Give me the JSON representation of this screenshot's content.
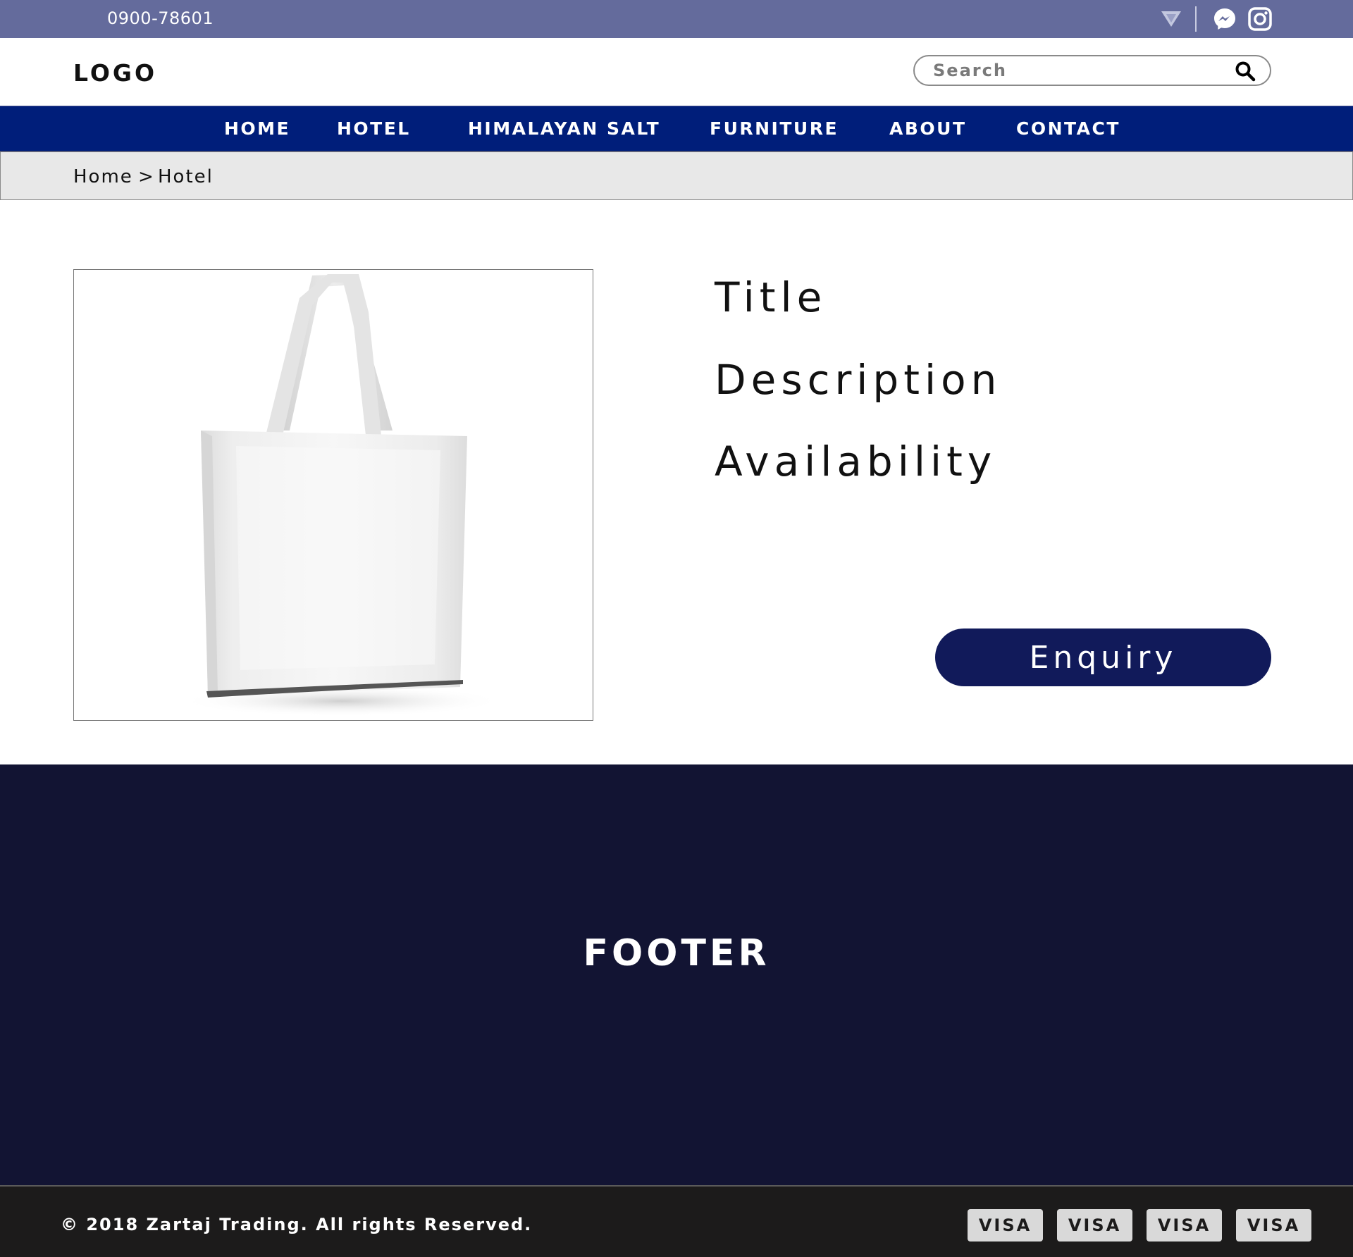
{
  "topbar": {
    "phone": "0900-78601",
    "icons": [
      "dropdown-triangle-icon",
      "messenger-icon",
      "instagram-icon"
    ]
  },
  "header": {
    "logo": "LOGO",
    "search_placeholder": "Search",
    "search_icon": "search-icon"
  },
  "nav": {
    "items": [
      {
        "label": "HOME"
      },
      {
        "label": "HOTEL"
      },
      {
        "label": "HIMALAYAN SALT"
      },
      {
        "label": "FURNITURE"
      },
      {
        "label": "ABOUT"
      },
      {
        "label": "CONTACT"
      }
    ]
  },
  "breadcrumb": {
    "home": "Home",
    "separator": ">",
    "current": "Hotel"
  },
  "product": {
    "title": "Title",
    "description": "Description",
    "availability": "Availability",
    "enquiry_label": "Enquiry"
  },
  "footer": {
    "title": "FOOTER",
    "copyright": "© 2018 Zartaj Trading. All rights Reserved.",
    "payments": [
      "VISA",
      "VISA",
      "VISA",
      "VISA"
    ]
  },
  "colors": {
    "topbar": "#646b9c",
    "nav": "#001e7a",
    "breadcrumb": "#e8e8e8",
    "enquiry_button": "#111a5a",
    "footer": "#121433",
    "bottombar": "#1c1b1b"
  }
}
